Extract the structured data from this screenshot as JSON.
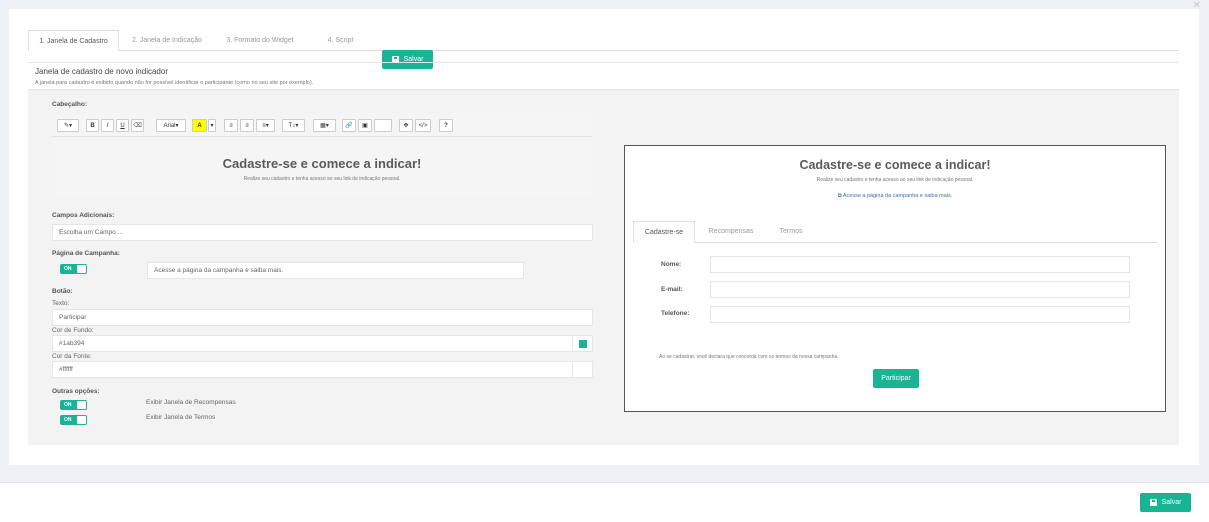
{
  "tabs": [
    {
      "label": "1. Janela de Cadastro"
    },
    {
      "label": "2. Janela de Indicação"
    },
    {
      "label": "3. Formato do Widget"
    },
    {
      "label": "4. Script"
    }
  ],
  "save_label": "Salvar",
  "section": {
    "title": "Janela de cadastro de novo indicador",
    "subtitle": "A janela para cadastro é exibido quando não for possível identificar o participante (como no seu site por exemplo)."
  },
  "header": {
    "label": "Cabeçalho:",
    "font_name": "Arial",
    "editor_title": "Cadastre-se e comece a indicar!",
    "editor_subtitle": "Realize seu cadastro e tenha acesso ao seu link de indicação pessoal."
  },
  "campos": {
    "label": "Campos Adicionais:",
    "placeholder": "Escolha um Campo ..."
  },
  "campanha": {
    "label": "Página de Campanha:",
    "toggle": "ON",
    "link_text": "Acesse a página da campanha e saiba mais."
  },
  "botao": {
    "label": "Botão:",
    "texto_label": "Texto:",
    "texto_value": "Participar",
    "fundo_label": "Cor de Fundo:",
    "fundo_value": "#1ab394",
    "fonte_label": "Cor da Fonte:",
    "fonte_value": "#ffffff"
  },
  "outras": {
    "label": "Outras opções:",
    "opt1_toggle": "ON",
    "opt1_label": "Exibir Janela de Recompensas",
    "opt2_toggle": "ON",
    "opt2_label": "Exibir Janela de Termos"
  },
  "preview": {
    "title": "Cadastre-se e comece a indicar!",
    "subtitle": "Realize seu cadastro e tenha acesso ao seu link de indicação pessoal.",
    "link": "Acesse a página da campanha e saiba mais.",
    "tabs": [
      "Cadastre-se",
      "Recompensas",
      "Termos"
    ],
    "fields": [
      "Nome:",
      "E-mail:",
      "Telefone:"
    ],
    "terms": "Ao se cadastrar, você declara que concorda com os termos da nossa campanha.",
    "button": "Participar"
  },
  "colors": {
    "accent": "#1ab394"
  }
}
